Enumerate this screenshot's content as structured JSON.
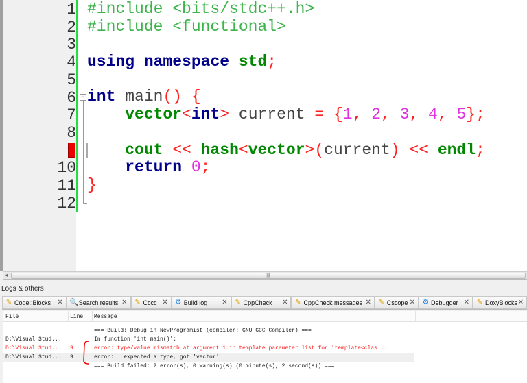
{
  "editor": {
    "line_numbers": [
      "1",
      "2",
      "3",
      "4",
      "5",
      "6",
      "7",
      "8",
      "9",
      "10",
      "11",
      "12"
    ],
    "error_line": "9",
    "lines": [
      [
        {
          "t": "#include <bits/stdc++.h>",
          "c": "pp"
        }
      ],
      [
        {
          "t": "#include <functional>",
          "c": "pp"
        }
      ],
      [],
      [
        {
          "t": "using",
          "c": "kw"
        },
        {
          "t": " "
        },
        {
          "t": "namespace",
          "c": "kw"
        },
        {
          "t": " "
        },
        {
          "t": "std",
          "c": "ty"
        },
        {
          "t": ";",
          "c": "op"
        }
      ],
      [],
      [
        {
          "t": "int",
          "c": "kw"
        },
        {
          "t": " main"
        },
        {
          "t": "()",
          "c": "op"
        },
        {
          "t": " "
        },
        {
          "t": "{",
          "c": "op"
        }
      ],
      [
        {
          "t": "    "
        },
        {
          "t": "vector",
          "c": "ty"
        },
        {
          "t": "<",
          "c": "op"
        },
        {
          "t": "int",
          "c": "kw"
        },
        {
          "t": ">",
          "c": "op"
        },
        {
          "t": " current "
        },
        {
          "t": "=",
          "c": "op"
        },
        {
          "t": " "
        },
        {
          "t": "{",
          "c": "op"
        },
        {
          "t": "1",
          "c": "nm"
        },
        {
          "t": ", ",
          "c": "op"
        },
        {
          "t": "2",
          "c": "nm"
        },
        {
          "t": ", ",
          "c": "op"
        },
        {
          "t": "3",
          "c": "nm"
        },
        {
          "t": ", ",
          "c": "op"
        },
        {
          "t": "4",
          "c": "nm"
        },
        {
          "t": ", ",
          "c": "op"
        },
        {
          "t": "5",
          "c": "nm"
        },
        {
          "t": "};",
          "c": "op"
        }
      ],
      [],
      [
        {
          "t": "    "
        },
        {
          "t": "cout",
          "c": "ty"
        },
        {
          "t": " "
        },
        {
          "t": "<<",
          "c": "op"
        },
        {
          "t": " "
        },
        {
          "t": "hash",
          "c": "ty"
        },
        {
          "t": "<",
          "c": "op"
        },
        {
          "t": "vector",
          "c": "ty"
        },
        {
          "t": ">(",
          "c": "op"
        },
        {
          "t": "current"
        },
        {
          "t": ")",
          "c": "op"
        },
        {
          "t": " "
        },
        {
          "t": "<<",
          "c": "op"
        },
        {
          "t": " "
        },
        {
          "t": "endl",
          "c": "ty"
        },
        {
          "t": ";",
          "c": "op"
        }
      ],
      [
        {
          "t": "    "
        },
        {
          "t": "return",
          "c": "kw"
        },
        {
          "t": " "
        },
        {
          "t": "0",
          "c": "nm"
        },
        {
          "t": ";",
          "c": "op"
        }
      ],
      [
        {
          "t": "}",
          "c": "op"
        }
      ],
      []
    ]
  },
  "logs": {
    "title": "Logs & others",
    "tabs": [
      {
        "label": "Code::Blocks",
        "icon": "pencil-icon"
      },
      {
        "label": "Search results",
        "icon": "magnifier-icon"
      },
      {
        "label": "Cccc",
        "icon": "pencil-icon"
      },
      {
        "label": "Build log",
        "icon": "gear-icon"
      },
      {
        "label": "CppCheck",
        "icon": "pencil-icon"
      },
      {
        "label": "CppCheck messages",
        "icon": "pencil-icon"
      },
      {
        "label": "Cscope",
        "icon": "pencil-icon"
      },
      {
        "label": "Debugger",
        "icon": "gear-icon"
      },
      {
        "label": "DoxyBlocks",
        "icon": "pencil-icon"
      }
    ],
    "columns": {
      "file": "File",
      "line": "Line",
      "message": "Message"
    },
    "rows": [
      {
        "file": "",
        "line": "",
        "message": "=== Build: Debug in NewProgramist (compiler: GNU GCC Compiler) ===",
        "type": "info"
      },
      {
        "file": "D:\\Visual Stud...",
        "line": "",
        "message": "In function 'int main()':",
        "type": "info"
      },
      {
        "file": "D:\\Visual Stud...",
        "line": "9",
        "message": "error: type/value mismatch at argument 1 in template parameter list for 'template<clas...",
        "type": "error"
      },
      {
        "file": "D:\\Visual Stud...",
        "line": "9",
        "message": "error:   expected a type, got 'vector'",
        "type": "selected"
      },
      {
        "file": "",
        "line": "",
        "message": "=== Build failed: 2 error(s), 0 warning(s) (0 minute(s), 2 second(s)) ===",
        "type": "info"
      }
    ]
  }
}
